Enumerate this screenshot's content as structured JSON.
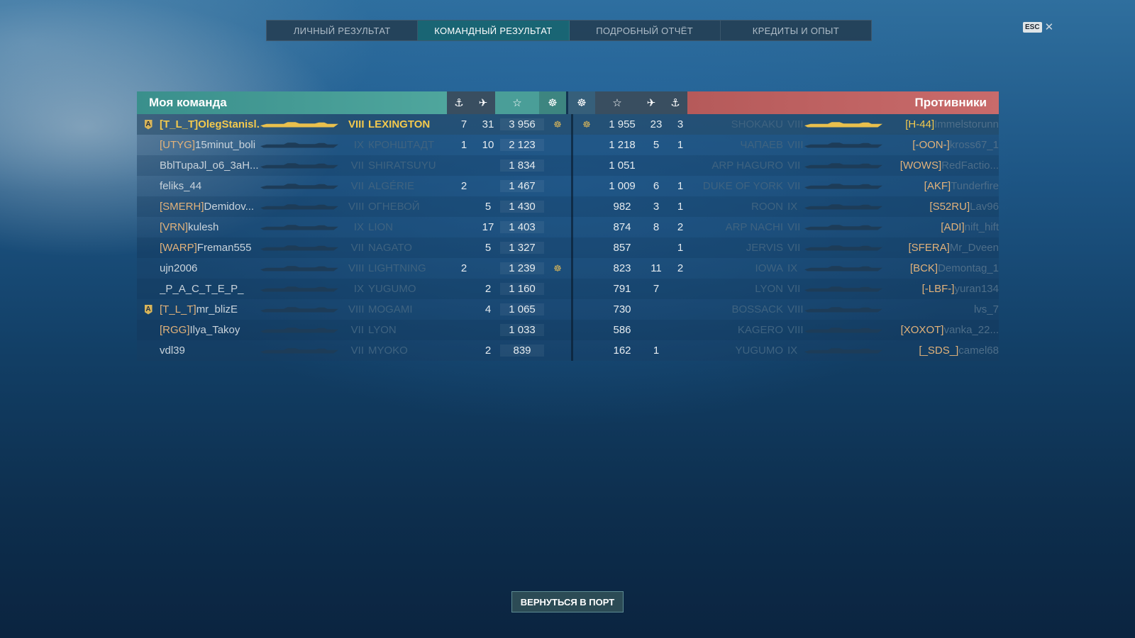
{
  "tabs": [
    {
      "label": "ЛИЧНЫЙ РЕЗУЛЬТАТ"
    },
    {
      "label": "КОМАНДНЫЙ РЕЗУЛЬТАТ"
    },
    {
      "label": "ПОДРОБНЫЙ ОТЧЁТ"
    },
    {
      "label": "КРЕДИТЫ И ОПЫТ"
    }
  ],
  "esc": {
    "key": "ESC",
    "close": "✕"
  },
  "header": {
    "my_team": "Моя команда",
    "enemy_team": "Противники",
    "icons": {
      "ships_destroyed": "⚓",
      "planes_destroyed": "✈",
      "xp": "☆",
      "medal": "☸"
    }
  },
  "my_team": [
    {
      "badge": "A",
      "clan": "[T_L_T]",
      "name": "OlegStanisl...",
      "tier": "VIII",
      "ship": "LEXINGTON",
      "a": "7",
      "b": "31",
      "xp": "3 956",
      "medal": "☸",
      "me": true
    },
    {
      "badge": "",
      "clan": "[UTYG]",
      "name": "15minut_boli",
      "tier": "IX",
      "ship": "КРОНШТАДТ",
      "a": "1",
      "b": "10",
      "xp": "2 123",
      "medal": ""
    },
    {
      "badge": "",
      "clan": "",
      "name": "BblTupaJl_o6_3aH...",
      "tier": "VII",
      "ship": "SHIRATSUYU",
      "a": "",
      "b": "",
      "xp": "1 834",
      "medal": ""
    },
    {
      "badge": "",
      "clan": "",
      "name": "feliks_44",
      "tier": "VII",
      "ship": "ALGÉRIE",
      "a": "2",
      "b": "",
      "xp": "1 467",
      "medal": ""
    },
    {
      "badge": "",
      "clan": "[SMERH]",
      "name": "Demidov...",
      "tier": "VIII",
      "ship": "ОГНЕВОЙ",
      "a": "",
      "b": "5",
      "xp": "1 430",
      "medal": ""
    },
    {
      "badge": "",
      "clan": "[VRN]",
      "name": "kulesh",
      "tier": "IX",
      "ship": "LION",
      "a": "",
      "b": "17",
      "xp": "1 403",
      "medal": ""
    },
    {
      "badge": "",
      "clan": "[WARP]",
      "name": "Freman555",
      "tier": "VII",
      "ship": "NAGATO",
      "a": "",
      "b": "5",
      "xp": "1 327",
      "medal": ""
    },
    {
      "badge": "",
      "clan": "",
      "name": "ujn2006",
      "tier": "VIII",
      "ship": "LIGHTNING",
      "a": "2",
      "b": "",
      "xp": "1 239",
      "medal": "☸"
    },
    {
      "badge": "",
      "clan": "",
      "name": "_P_A_C_T_E_P_",
      "tier": "IX",
      "ship": "YUGUMO",
      "a": "",
      "b": "2",
      "xp": "1 160",
      "medal": ""
    },
    {
      "badge": "A",
      "clan": "[T_L_T]",
      "name": "mr_blizE",
      "tier": "VIII",
      "ship": "MOGAMI",
      "a": "",
      "b": "4",
      "xp": "1 065",
      "medal": ""
    },
    {
      "badge": "",
      "clan": "[RGG]",
      "name": "Ilya_Takoy",
      "tier": "VII",
      "ship": "LYON",
      "a": "",
      "b": "",
      "xp": "1 033",
      "medal": ""
    },
    {
      "badge": "",
      "clan": "",
      "name": "vdl39",
      "tier": "VII",
      "ship": "MYOKO",
      "a": "",
      "b": "2",
      "xp": "839",
      "medal": ""
    }
  ],
  "enemy_team": [
    {
      "medal": "☸",
      "xp": "1 955",
      "b": "23",
      "a": "3",
      "ship": "SHOKAKU",
      "tier": "VIII",
      "clan": "[H-44]",
      "name": "Immelstorunn"
    },
    {
      "medal": "",
      "xp": "1 218",
      "b": "5",
      "a": "1",
      "ship": "ЧАПАЕВ",
      "tier": "VIII",
      "clan": "[-OON-]",
      "name": "kross67_1"
    },
    {
      "medal": "",
      "xp": "1 051",
      "b": "",
      "a": "",
      "ship": "ARP HAGURO",
      "tier": "VII",
      "clan": "[WOWS]",
      "name": "RedFactio..."
    },
    {
      "medal": "",
      "xp": "1 009",
      "b": "6",
      "a": "1",
      "ship": "DUKE OF YORK",
      "tier": "VII",
      "clan": "[AKF]",
      "name": "Tunderfire"
    },
    {
      "medal": "",
      "xp": "982",
      "b": "3",
      "a": "1",
      "ship": "ROON",
      "tier": "IX",
      "clan": "[S52RU]",
      "name": "Lav96"
    },
    {
      "medal": "",
      "xp": "874",
      "b": "8",
      "a": "2",
      "ship": "ARP NACHI",
      "tier": "VII",
      "clan": "[ADI]",
      "name": "nift_hift"
    },
    {
      "medal": "",
      "xp": "857",
      "b": "",
      "a": "1",
      "ship": "JERVIS",
      "tier": "VII",
      "clan": "[SFERA]",
      "name": "Mr_Dveen"
    },
    {
      "medal": "",
      "xp": "823",
      "b": "11",
      "a": "2",
      "ship": "IOWA",
      "tier": "IX",
      "clan": "[BCK]",
      "name": "Demontag_1"
    },
    {
      "medal": "",
      "xp": "791",
      "b": "7",
      "a": "",
      "ship": "LYON",
      "tier": "VII",
      "clan": "[-LBF-]",
      "name": "yuran134"
    },
    {
      "medal": "",
      "xp": "730",
      "b": "",
      "a": "",
      "ship": "BOSSACK",
      "tier": "VIII",
      "clan": "",
      "name": "lvs_7"
    },
    {
      "medal": "",
      "xp": "586",
      "b": "",
      "a": "",
      "ship": "KAGERO",
      "tier": "VIII",
      "clan": "[XOXOT]",
      "name": "vanka_22..."
    },
    {
      "medal": "",
      "xp": "162",
      "b": "1",
      "a": "",
      "ship": "YUGUMO",
      "tier": "IX",
      "clan": "[_SDS_]",
      "name": "camel68"
    }
  ],
  "footer": {
    "back_label": "ВЕРНУТЬСЯ В ПОРТ"
  },
  "colors": {
    "my_team_header": "#4fa69d",
    "enemy_header": "#c96b6b",
    "highlight": "#f3c94d"
  }
}
